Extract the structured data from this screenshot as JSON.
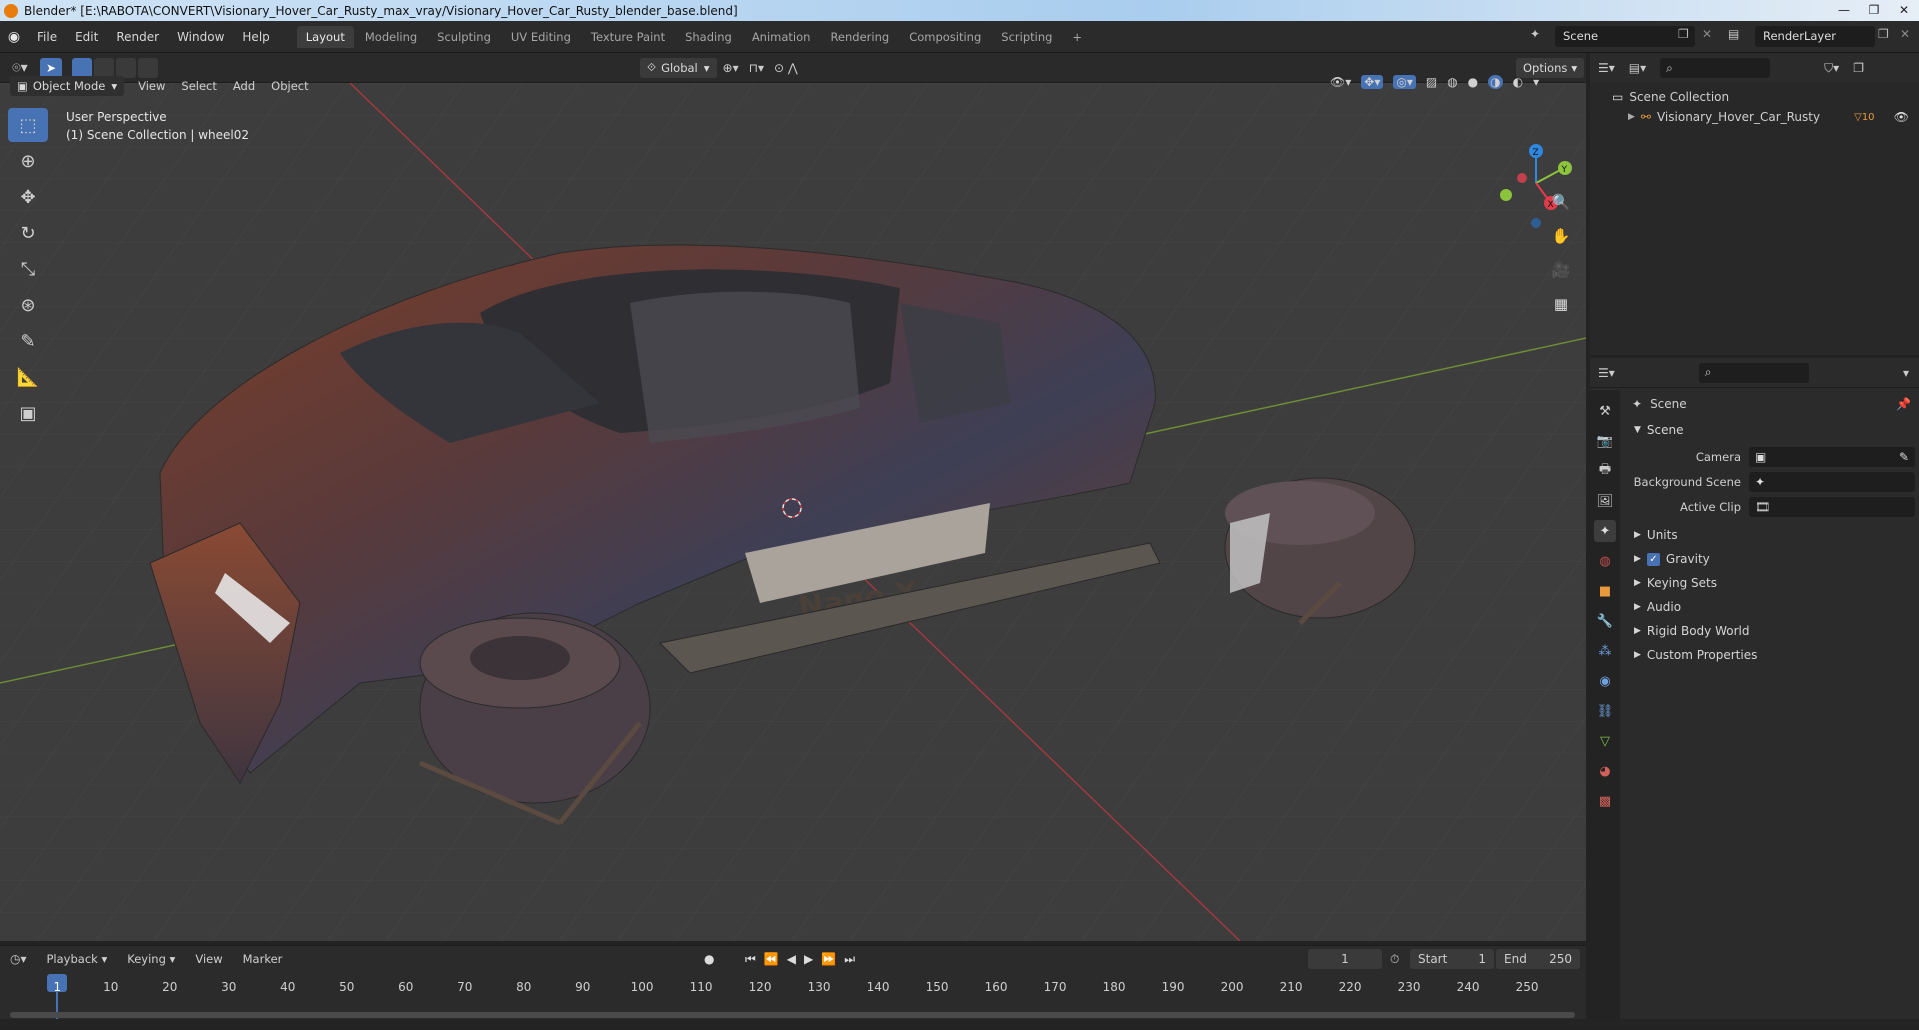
{
  "window": {
    "title": "Blender* [E:\\RABOTA\\CONVERT\\Visionary_Hover_Car_Rusty_max_vray/Visionary_Hover_Car_Rusty_blender_base.blend]"
  },
  "menu": [
    "File",
    "Edit",
    "Render",
    "Window",
    "Help"
  ],
  "workspaces": [
    "Layout",
    "Modeling",
    "Sculpting",
    "UV Editing",
    "Texture Paint",
    "Shading",
    "Animation",
    "Rendering",
    "Compositing",
    "Scripting"
  ],
  "active_workspace": "Layout",
  "scene_name": "Scene",
  "render_layer": "RenderLayer",
  "viewport": {
    "transform_orientation": "Global",
    "options_label": "Options",
    "mode": "Object Mode",
    "menus": [
      "View",
      "Select",
      "Add",
      "Object"
    ],
    "view_name": "User Perspective",
    "collection_info": "(1) Scene Collection | wheel02",
    "model_label": "Nano-X",
    "gizmo_axes": {
      "z": "Z",
      "y": "Y",
      "x": "X"
    }
  },
  "outliner": {
    "root": "Scene Collection",
    "item": "Visionary_Hover_Car_Rusty",
    "item_badge": "10"
  },
  "properties": {
    "header": "Scene",
    "section": "Scene",
    "fields": [
      {
        "label": "Camera",
        "value": ""
      },
      {
        "label": "Background Scene",
        "value": ""
      },
      {
        "label": "Active Clip",
        "value": ""
      }
    ],
    "panels": [
      "Units",
      "Gravity",
      "Keying Sets",
      "Audio",
      "Rigid Body World",
      "Custom Properties"
    ],
    "gravity_checked": true
  },
  "timeline": {
    "menus": [
      "Playback",
      "Keying",
      "View",
      "Marker"
    ],
    "current_frame": "1",
    "start_label": "Start",
    "start": "1",
    "end_label": "End",
    "end": "250",
    "ticks": [
      "1",
      "10",
      "20",
      "30",
      "40",
      "50",
      "60",
      "70",
      "80",
      "90",
      "100",
      "110",
      "120",
      "130",
      "140",
      "150",
      "160",
      "170",
      "180",
      "190",
      "200",
      "210",
      "220",
      "230",
      "240",
      "250"
    ]
  },
  "colors": {
    "accent": "#4772b3",
    "header": "#2b2b2b",
    "viewport": "#3d3d3d",
    "x_axis": "#e23b4a",
    "y_axis": "#8cc43c",
    "z_axis": "#2f87e0"
  }
}
